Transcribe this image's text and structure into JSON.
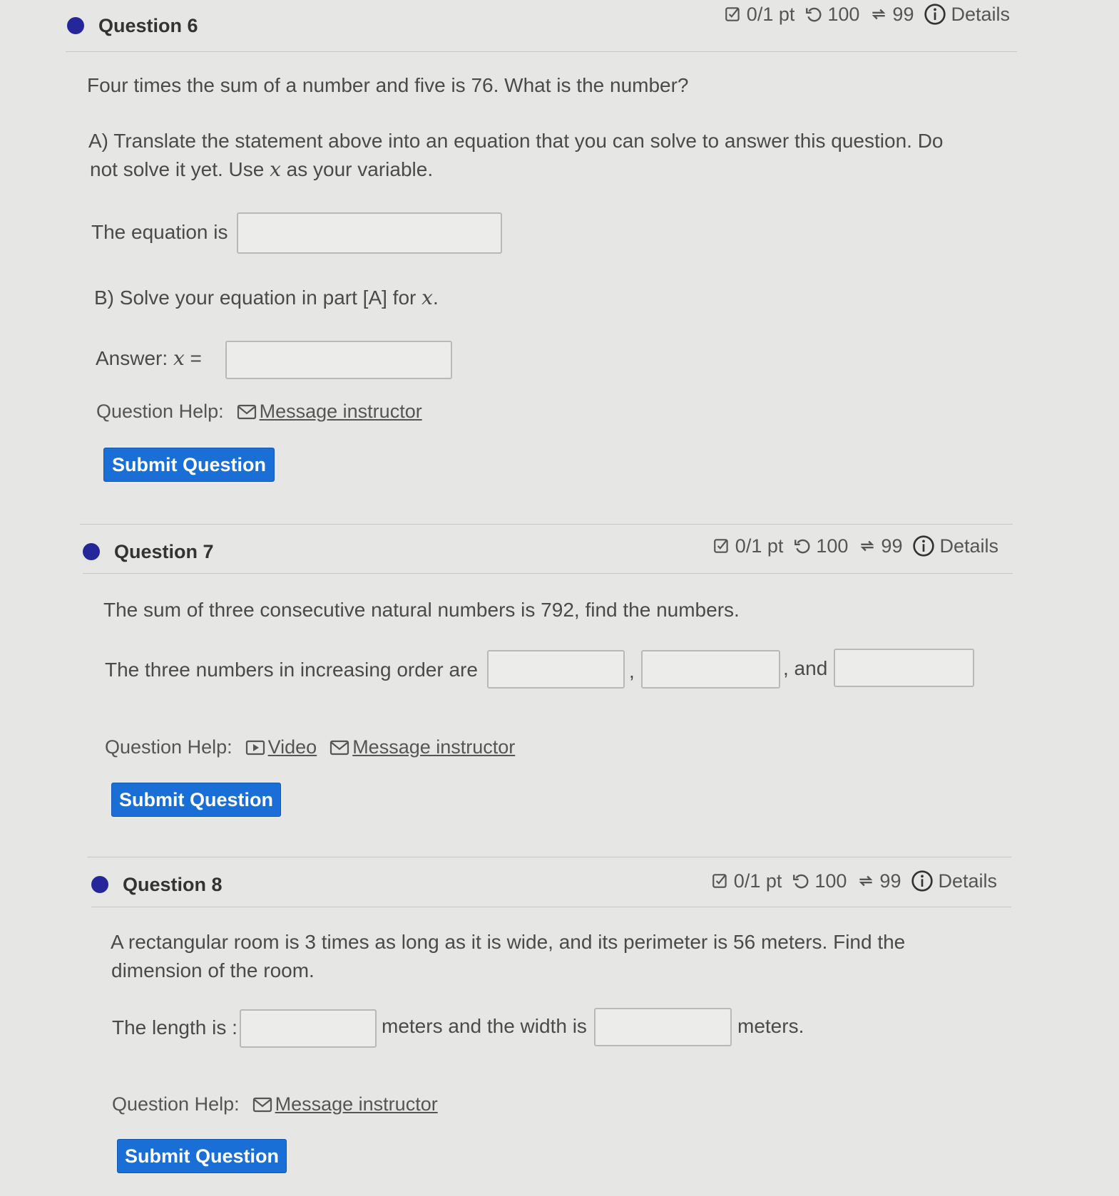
{
  "q6": {
    "title": "Question 6",
    "score": "0/1 pt",
    "retries": "100",
    "attempts": "99",
    "details": "Details",
    "prompt": "Four times the sum of a number and five is 76. What is the number?",
    "partA_line1": "A) Translate the statement above into an equation that you can solve to answer this question. Do",
    "partA_line2_pre": "not solve it yet. Use ",
    "partA_var": "x",
    "partA_line2_post": " as your variable.",
    "equation_label": "The equation is",
    "partB_pre": "B) Solve your equation in part [A] for ",
    "partB_var": "x",
    "partB_post": ".",
    "answer_label": "Answer: ",
    "answer_var": "x",
    "answer_eq": " =",
    "help_label": "Question Help:",
    "message_link": "Message instructor",
    "submit": "Submit Question"
  },
  "q7": {
    "title": "Question 7",
    "score": "0/1 pt",
    "retries": "100",
    "attempts": "99",
    "details": "Details",
    "prompt": "The sum of three consecutive natural numbers is 792, find the numbers.",
    "numbers_label": "The three numbers in increasing order are",
    "comma1": ",",
    "comma_and": ", and",
    "help_label": "Question Help:",
    "video_link": "Video",
    "message_link": "Message instructor",
    "submit": "Submit Question"
  },
  "q8": {
    "title": "Question 8",
    "score": "0/1 pt",
    "retries": "100",
    "attempts": "99",
    "details": "Details",
    "prompt_line1": "A rectangular room is 3 times as long as it is wide, and its perimeter is 56 meters. Find the",
    "prompt_line2": "dimension of the room.",
    "length_label": "The length is :",
    "width_label": "meters and the width is",
    "meters_end": "meters.",
    "help_label": "Question Help:",
    "message_link": "Message instructor",
    "submit": "Submit Question"
  },
  "icons": {
    "score": "checkbox-icon",
    "retries": "retry-icon",
    "attempts": "refresh-icon",
    "details": "info-icon",
    "message": "mail-icon",
    "video": "video-icon"
  },
  "colors": {
    "bullet": "#24269a",
    "button": "#1a6fd6",
    "background": "#e6e6e4"
  }
}
